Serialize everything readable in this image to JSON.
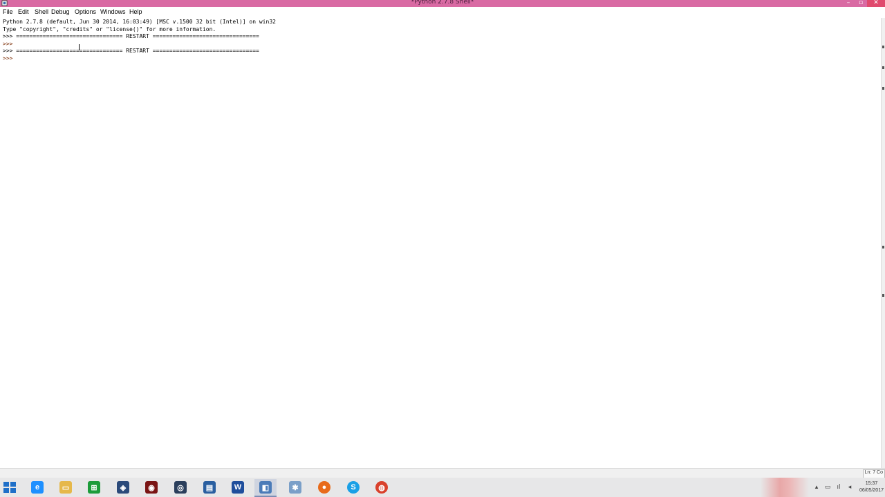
{
  "window": {
    "title": "*Python 2.7.8 Shell*",
    "minimize": "–",
    "maximize": "▫",
    "close": "✕"
  },
  "menu": [
    "File",
    "Edit",
    "Shell",
    "Debug",
    "Options",
    "Windows",
    "Help"
  ],
  "shell": {
    "lines": [
      "Python 2.7.8 (default, Jun 30 2014, 16:03:49) [MSC v.1500 32 bit (Intel)] on win32",
      "Type \"copyright\", \"credits\" or \"license()\" for more information.",
      ">>> ================================ RESTART ================================",
      ">>> ",
      ">>> ================================ RESTART ================================",
      ">>> "
    ]
  },
  "status": {
    "position": "Ln: 7 Co"
  },
  "taskbar": {
    "apps": [
      {
        "name": "internet-explorer",
        "glyph": "e",
        "color": "#1e90ff"
      },
      {
        "name": "file-explorer",
        "glyph": "▭",
        "color": "#e6b84a"
      },
      {
        "name": "store",
        "glyph": "⊞",
        "color": "#1c9c3a"
      },
      {
        "name": "remote-app",
        "glyph": "◈",
        "color": "#2b4a7a"
      },
      {
        "name": "acrobat",
        "glyph": "◉",
        "color": "#7a1414"
      },
      {
        "name": "media-app",
        "glyph": "◎",
        "color": "#2b3f5c"
      },
      {
        "name": "monitor-app",
        "glyph": "▤",
        "color": "#2a5fa0"
      },
      {
        "name": "word",
        "glyph": "W",
        "color": "#1f4e9c"
      },
      {
        "name": "python-idle",
        "glyph": "◧",
        "color": "#4b7bb8"
      },
      {
        "name": "tool-app",
        "glyph": "✱",
        "color": "#7a9fc8"
      },
      {
        "name": "firefox",
        "glyph": "●",
        "color": "#e86a1a"
      },
      {
        "name": "skype",
        "glyph": "S",
        "color": "#1aa0e6"
      },
      {
        "name": "chrome",
        "glyph": "◍",
        "color": "#d9412c"
      }
    ],
    "active_app": "python-idle",
    "clock_time": "15:37",
    "clock_date": "06/05/2017"
  },
  "colors": {
    "titlebar": "#d96aa3",
    "prompt": "#7a2a00"
  }
}
